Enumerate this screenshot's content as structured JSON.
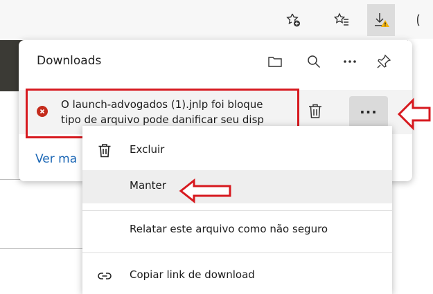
{
  "panel": {
    "title": "Downloads",
    "icons": [
      "folder-icon",
      "search-icon",
      "more-icon",
      "pin-icon"
    ],
    "download": {
      "line1": "O launch-advogados (1).jnlp foi bloque",
      "line2": "tipo de arquivo pode danificar seu disp",
      "status": "blocked",
      "status_color": "#c42b1c"
    },
    "more_label": "···",
    "see_more": "Ver ma"
  },
  "context_menu": {
    "items": [
      {
        "label": "Excluir",
        "icon": "trash-icon"
      },
      {
        "label": "Manter",
        "icon": ""
      },
      {
        "label": "Relatar este arquivo como não seguro",
        "icon": ""
      },
      {
        "label": "Copiar link de download",
        "icon": "link-icon"
      }
    ]
  },
  "annotations": {
    "color": "#d7191f"
  }
}
